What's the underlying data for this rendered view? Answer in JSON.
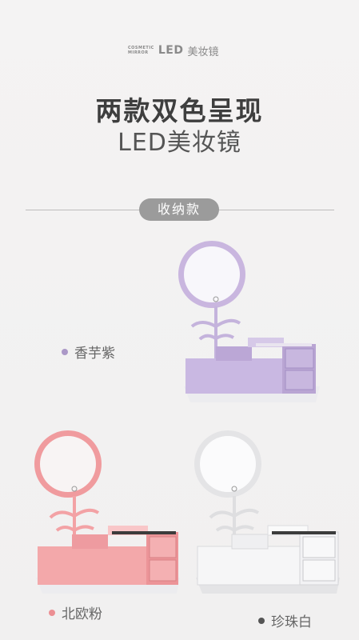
{
  "brand": {
    "line1": "COSMETIC",
    "line2": "MIRROR",
    "led": "LED",
    "cn": "美妆镜"
  },
  "headline": {
    "line1": "两款双色呈现",
    "line2": "LED美妆镜"
  },
  "section": {
    "label": "收纳款"
  },
  "variants": [
    {
      "name": "香芋紫",
      "color": "#ab98c7"
    },
    {
      "name": "北欧粉",
      "color": "#ec8f93"
    },
    {
      "name": "珍珠白",
      "color": "#555555"
    }
  ]
}
